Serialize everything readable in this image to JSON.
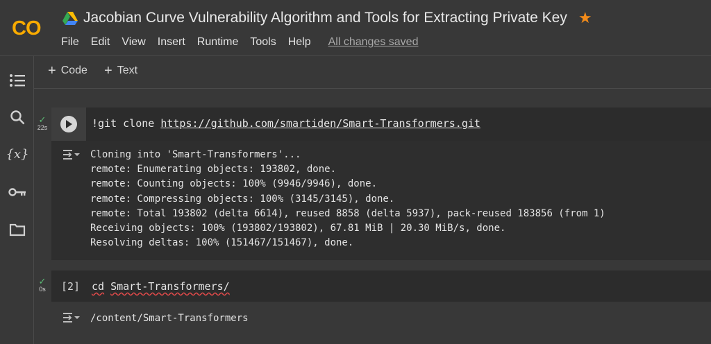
{
  "header": {
    "app_logo": "CO",
    "drive_icon": "google-drive-icon",
    "title": "Jacobian Curve Vulnerability Algorithm and Tools for Extracting Private Key",
    "star_icon": "star-icon",
    "menu": [
      "File",
      "Edit",
      "View",
      "Insert",
      "Runtime",
      "Tools",
      "Help"
    ],
    "save_status": "All changes saved"
  },
  "sidebar": {
    "icons": [
      "table-of-contents-icon",
      "search-icon",
      "variables-icon",
      "secrets-key-icon",
      "files-folder-icon"
    ],
    "variables_label": "{x}"
  },
  "toolbar": {
    "add_code": "Code",
    "add_text": "Text"
  },
  "cells": [
    {
      "status": "success",
      "exec_time": "22s",
      "code_prefix": "!git clone ",
      "code_url": "https://github.com/smartiden/Smart-Transformers.git",
      "output": [
        "Cloning into 'Smart-Transformers'...",
        "remote: Enumerating objects: 193802, done.",
        "remote: Counting objects: 100% (9946/9946), done.",
        "remote: Compressing objects: 100% (3145/3145), done.",
        "remote: Total 193802 (delta 6614), reused 8858 (delta 5937), pack-reused 183856 (from 1)",
        "Receiving objects: 100% (193802/193802), 67.81 MiB | 20.30 MiB/s, done.",
        "Resolving deltas: 100% (151467/151467), done."
      ]
    },
    {
      "status": "success",
      "exec_time": "0s",
      "exec_count": "[2]",
      "code_cmd": "cd",
      "code_arg": "Smart-Transformers/",
      "output": [
        "/content/Smart-Transformers"
      ]
    }
  ],
  "colors": {
    "background": "#383838",
    "code_background": "#2c2c2c",
    "accent_star": "#f28b1a",
    "success_check": "#5bb974",
    "logo_orange": "#f9ab00"
  }
}
